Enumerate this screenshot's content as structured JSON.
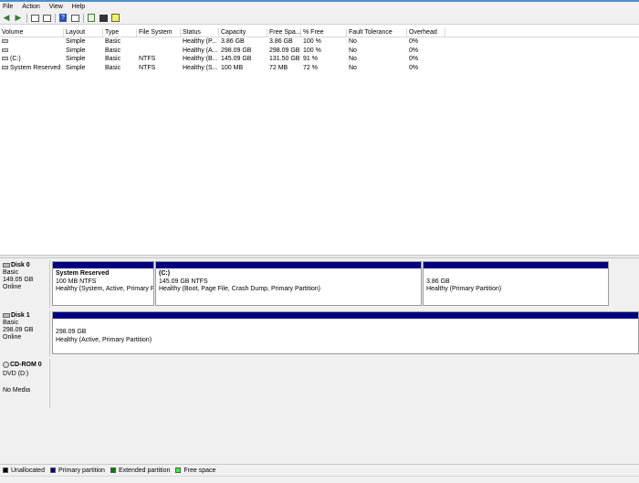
{
  "menu": [
    "File",
    "Action",
    "View",
    "Help"
  ],
  "columns": [
    "Volume",
    "Layout",
    "Type",
    "File System",
    "Status",
    "Capacity",
    "Free Spa...",
    "% Free",
    "Fault Tolerance",
    "Overhead"
  ],
  "rows": [
    [
      "",
      "Simple",
      "Basic",
      "",
      "Healthy (P...",
      "3.86 GB",
      "3.86 GB",
      "100 %",
      "No",
      "0%"
    ],
    [
      "",
      "Simple",
      "Basic",
      "",
      "Healthy (A...",
      "298.09 GB",
      "298.09 GB",
      "100 %",
      "No",
      "0%"
    ],
    [
      "(C:)",
      "Simple",
      "Basic",
      "NTFS",
      "Healthy (B...",
      "145.09 GB",
      "131.50 GB",
      "91 %",
      "No",
      "0%"
    ],
    [
      "System Reserved",
      "Simple",
      "Basic",
      "NTFS",
      "Healthy (S...",
      "100 MB",
      "72 MB",
      "72 %",
      "No",
      "0%"
    ]
  ],
  "disks": {
    "disk0": {
      "name": "Disk 0",
      "type": "Basic",
      "size": "149.05 GB",
      "state": "Online",
      "parts": [
        {
          "label": "System Reserved",
          "size": "100 MB NTFS",
          "status": "Healthy (System, Active, Primary Pa"
        },
        {
          "label": "(C:)",
          "size": "145.09 GB NTFS",
          "status": "Healthy (Boot, Page File, Crash Dump, Primary Partition)"
        },
        {
          "label": "",
          "size": "3.86 GB",
          "status": "Healthy (Primary Partition)"
        }
      ]
    },
    "disk1": {
      "name": "Disk 1",
      "type": "Basic",
      "size": "298.09 GB",
      "state": "Online",
      "parts": [
        {
          "size": "298.09 GB",
          "status": "Healthy (Active, Primary Partition)"
        }
      ]
    },
    "cdrom0": {
      "name": "CD-ROM 0",
      "type": "DVD (D:)",
      "state": "No Media"
    }
  },
  "legend": [
    {
      "label": "Unallocated",
      "color": "#000000"
    },
    {
      "label": "Primary partition",
      "color": "#00007f"
    },
    {
      "label": "Extended partition",
      "color": "#007f00"
    },
    {
      "label": "Free space",
      "color": "#33ff33"
    }
  ]
}
